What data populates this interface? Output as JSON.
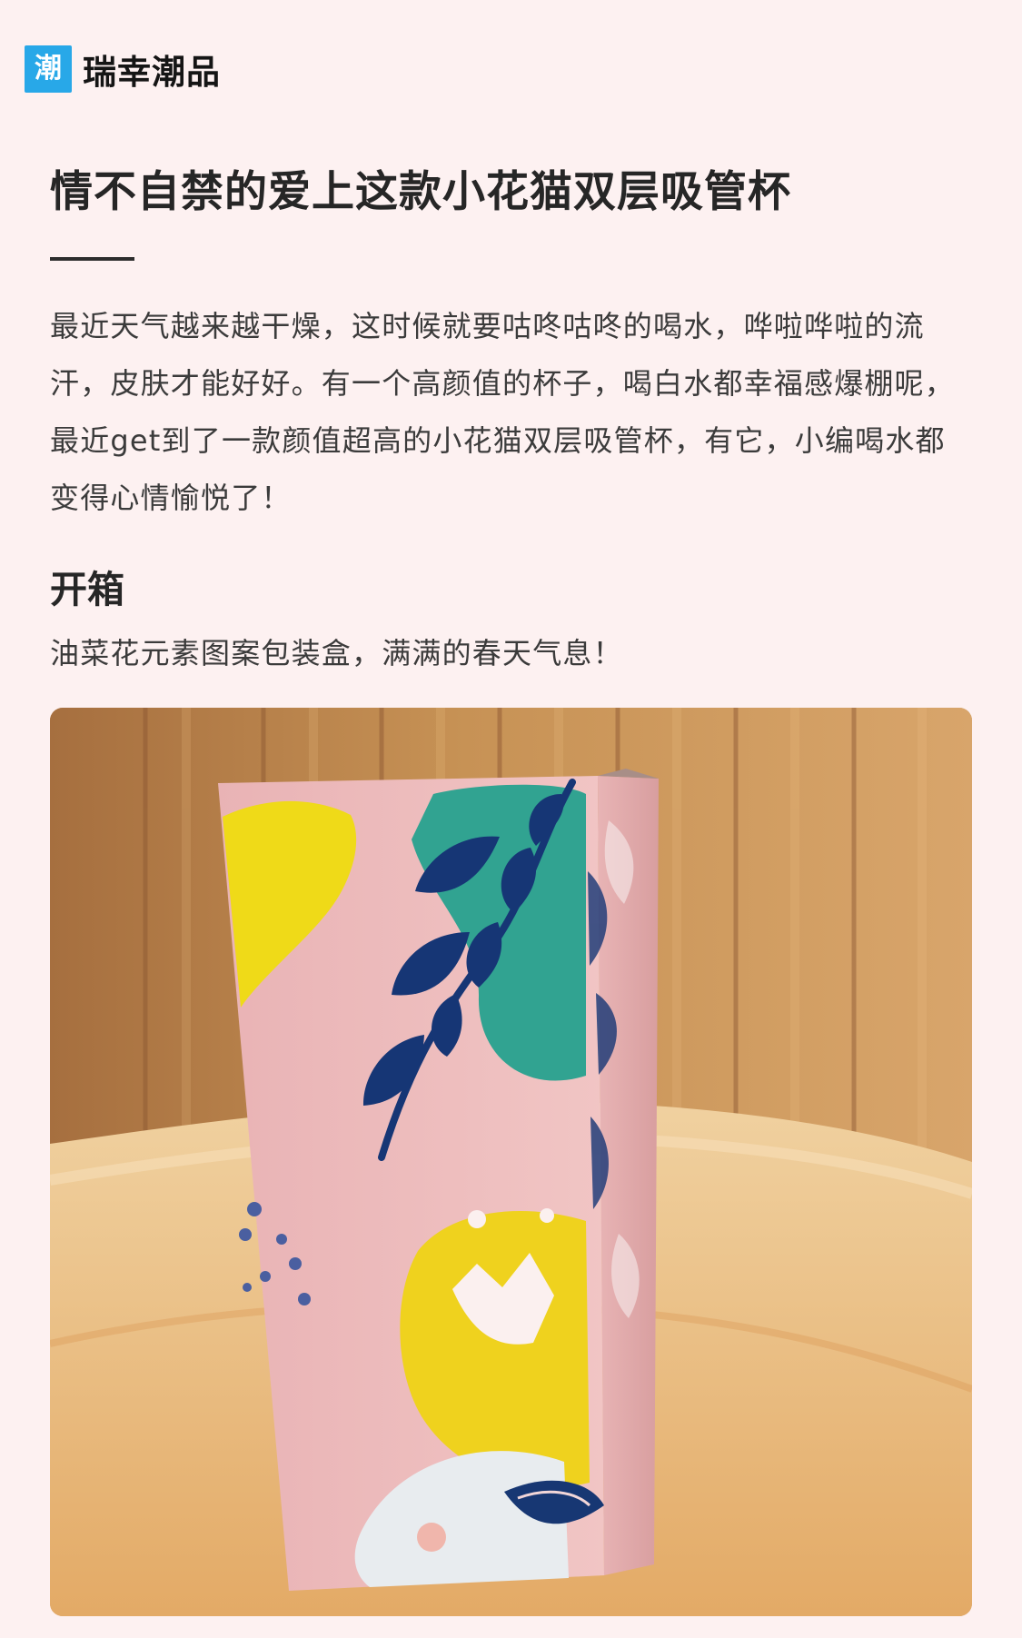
{
  "brand": {
    "logo_text": "潮",
    "name": "瑞幸潮品",
    "accent_color": "#28a8e8"
  },
  "article": {
    "title": "情不自禁的爱上这款小花猫双层吸管杯",
    "intro": "最近天气越来越干燥，这时候就要咕咚咕咚的喝水，哗啦哗啦的流汗，皮肤才能好好。有一个高颜值的杯子，喝白水都幸福感爆棚呢，最近get到了一款颜值超高的小花猫双层吸管杯，有它，小编喝水都变得心情愉悦了！",
    "sections": [
      {
        "heading": "开箱",
        "caption": "油菜花元素图案包装盒，满满的春天气息！"
      }
    ]
  },
  "colors": {
    "page_background": "#fdf1f1",
    "title_text": "#262626",
    "body_text": "#3b3b3b"
  }
}
